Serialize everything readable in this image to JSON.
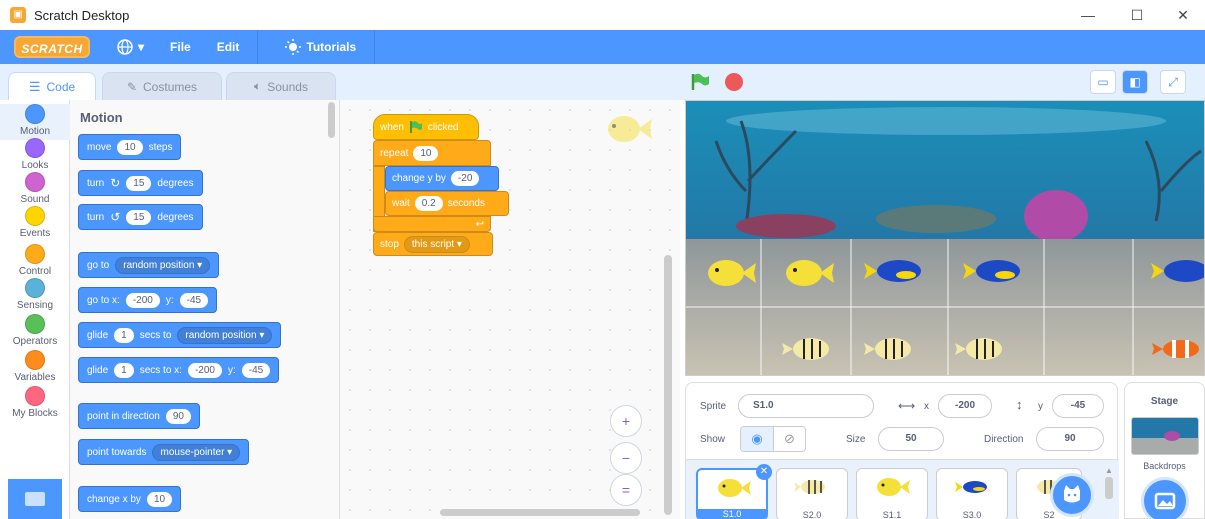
{
  "window": {
    "title": "Scratch Desktop",
    "minimize": "—",
    "maximize": "☐",
    "close": "✕"
  },
  "menubar": {
    "logo": "SCRATCH",
    "language_icon": "globe-icon",
    "language_caret": "▾",
    "file": "File",
    "edit": "Edit",
    "tutorials": "Tutorials"
  },
  "tabs": {
    "code": "Code",
    "costumes": "Costumes",
    "sounds": "Sounds"
  },
  "categories": [
    {
      "label": "Motion",
      "color": "#4c97ff"
    },
    {
      "label": "Looks",
      "color": "#9966ff"
    },
    {
      "label": "Sound",
      "color": "#cf63cf"
    },
    {
      "label": "Events",
      "color": "#ffd500"
    },
    {
      "label": "Control",
      "color": "#ffab19"
    },
    {
      "label": "Sensing",
      "color": "#5cb1d6"
    },
    {
      "label": "Operators",
      "color": "#59c059"
    },
    {
      "label": "Variables",
      "color": "#ff8c1a"
    },
    {
      "label": "My Blocks",
      "color": "#ff6680"
    }
  ],
  "palette": {
    "title": "Motion",
    "move": {
      "a": "move",
      "v": "10",
      "b": "steps"
    },
    "turn_right": {
      "a": "turn",
      "icon": "↻",
      "v": "15",
      "b": "degrees"
    },
    "turn_left": {
      "a": "turn",
      "icon": "↺",
      "v": "15",
      "b": "degrees"
    },
    "goto": {
      "a": "go to",
      "dd": "random position ▾"
    },
    "goto_xy": {
      "a": "go to x:",
      "x": "-200",
      "b": "y:",
      "y": "-45"
    },
    "glide_to": {
      "a": "glide",
      "v": "1",
      "b": "secs to",
      "dd": "random position ▾"
    },
    "glide_xy": {
      "a": "glide",
      "v": "1",
      "b": "secs to x:",
      "x": "-200",
      "c": "y:",
      "y": "-45"
    },
    "point_dir": {
      "a": "point in direction",
      "v": "90"
    },
    "point_towards": {
      "a": "point towards",
      "dd": "mouse-pointer ▾"
    },
    "change_x": {
      "a": "change x by",
      "v": "10"
    }
  },
  "script": {
    "when_a": "when",
    "when_b": "clicked",
    "repeat": "repeat",
    "repeat_v": "10",
    "change_y": "change y by",
    "change_y_v": "-20",
    "wait": "wait",
    "wait_v": "0.2",
    "wait_b": "seconds",
    "loop_arrow": "↩",
    "stop": "stop",
    "stop_dd": "this script ▾"
  },
  "zoom": {
    "in": "+",
    "out": "−",
    "reset": "="
  },
  "sprite_info": {
    "sprite_label": "Sprite",
    "sprite_name": "S1.0",
    "x_label": "x",
    "x_value": "-200",
    "y_label": "y",
    "y_value": "-45",
    "show_label": "Show",
    "size_label": "Size",
    "size_value": "50",
    "direction_label": "Direction",
    "direction_value": "90"
  },
  "sprites": [
    {
      "name": "S1.0"
    },
    {
      "name": "S2.0"
    },
    {
      "name": "S1.1"
    },
    {
      "name": "S3.0"
    },
    {
      "name": "S2"
    }
  ],
  "stage_target": {
    "label": "Stage",
    "backdrops": "Backdrops"
  }
}
